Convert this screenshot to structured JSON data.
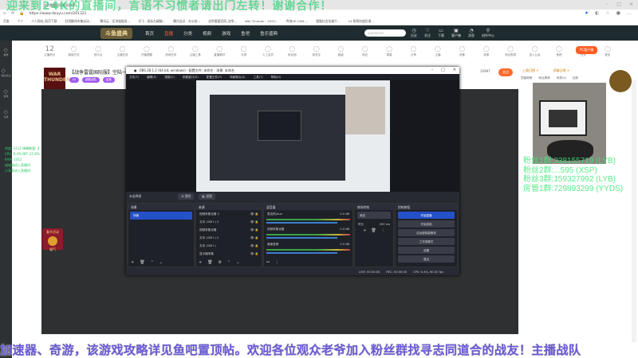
{
  "browser": {
    "tab_title": "战争雷霆国际服直播间",
    "url": "https://www.douyu.com/201321",
    "bookmarks": [
      "百度",
      "个人",
      "人人网站_网页下载",
      "好用翻译市集自动...",
      "腾讯云 - 区块链服务...",
      "讯飞 - 鼠标右键翻...",
      "腾讯会议 - 办公协...",
      "战争雷霆官网_战争...",
      "War Thunder - 2022...",
      "传统UE-CDN-...",
      "猫猫社会化媒介...",
      "24 帮帮快速反馈..."
    ]
  },
  "overlay_top": "迎来到24K的直播间，言语不习惯者请出门左转！谢谢合作！",
  "douyu": {
    "logo": "斗鱼盛典",
    "nav": [
      "首页",
      "直播",
      "分类",
      "视频",
      "游戏",
      "鱼吧",
      "鱼乐盛典"
    ],
    "search_placeholder": "pandoran",
    "header_icons": [
      "历史",
      "关注",
      "下载",
      "客户端",
      "消息",
      "创作中心"
    ],
    "sidebar": [
      "推荐",
      "我的关注",
      "游戏",
      "分类"
    ],
    "count": "12",
    "count_label": "主播积分",
    "toolbar": [
      "超能开关",
      "音乐台",
      "主播任务",
      "开播提醒",
      "房间任务",
      "主播工具",
      "直播素材",
      "礼物",
      "人工会员",
      "粉丝团",
      "我关注",
      "超级",
      "粉丝",
      "周星",
      "分享",
      "主播",
      "设置",
      "录像",
      "粉丝勋章",
      "加入公会",
      "鱼吧",
      "任务",
      "更多"
    ],
    "client_button": "PC客户端",
    "stream_title": "【战争雷霆国际服】空陆一体",
    "badges": [
      "LV",
      "超能战队",
      "鲨鱼"
    ],
    "follow_count": "10997",
    "follow_label": "关注"
  },
  "overlay_stats": [
    "热度: 1212  弹幕数量: 4",
    "CPU: 8.4%     INT: 25.8%",
    "RAM: 1012",
    "喵喵喵进入直播间",
    "小乖乖进入直播间"
  ],
  "gift": {
    "title": "春节活动",
    "label": "福气"
  },
  "obs": {
    "title": "OBS 28.1.2 (64 bit, windows) - 配置文件: 未命名 - 场景: 未命名",
    "menu": [
      "文件(F)",
      "编辑(E)",
      "视图(V)",
      "停靠窗口(D)",
      "配置文件(P)",
      "场景集合(S)",
      "工具(T)",
      "帮助(H)"
    ],
    "no_source": "未选择源",
    "props": "属性",
    "filters": "滤镜",
    "scenes_title": "场景",
    "scenes": [
      "场景"
    ],
    "sources_title": "来源",
    "sources": [
      "视频采集设备 2",
      "文本 (GDI+) 3",
      "视频采集设备",
      "文本 (GDI+) 2",
      "文本 (GDI+)",
      "显示器采集"
    ],
    "mixer_title": "混音器",
    "mixer": [
      {
        "name": "麦克风/Aux",
        "db": "0.0 dB"
      },
      {
        "name": "视频采集设备",
        "db": "0.0 dB"
      },
      {
        "name": "桌面音频",
        "db": "0.0 dB"
      }
    ],
    "trans_title": "转场特效",
    "transition": "渐变",
    "duration_label": "时长",
    "duration": "300 ms",
    "controls_title": "控制按钮",
    "controls": [
      "开始直播",
      "开始录制",
      "启动虚拟摄像机",
      "工作室模式",
      "设置",
      "退出"
    ],
    "status": {
      "live": "LIVE: 00:00:00",
      "rec": "REC: 00:00:00",
      "cpu": "CPU: 0.4%, 60.00 fps"
    }
  },
  "right": {
    "rank1": "上周日榜 >",
    "rank2": "贡献日榜 >",
    "tabs": [
      "贡献周榜",
      "粉丝周榜",
      "贵宾(4)",
      "钻粉"
    ]
  },
  "fan_groups": [
    "粉丝1群:338155719 (LYB)",
    "粉丝2群:...595 (XSP)",
    "粉丝3群:159327992 (LYB)",
    "房管1群:729893299 (YYDS)"
  ],
  "danmu": "加速器、奇游，该游戏攻略详见鱼吧置顶帖。欢迎各位观众老爷加入粉丝群找寻志同道合的战友！主播战队"
}
